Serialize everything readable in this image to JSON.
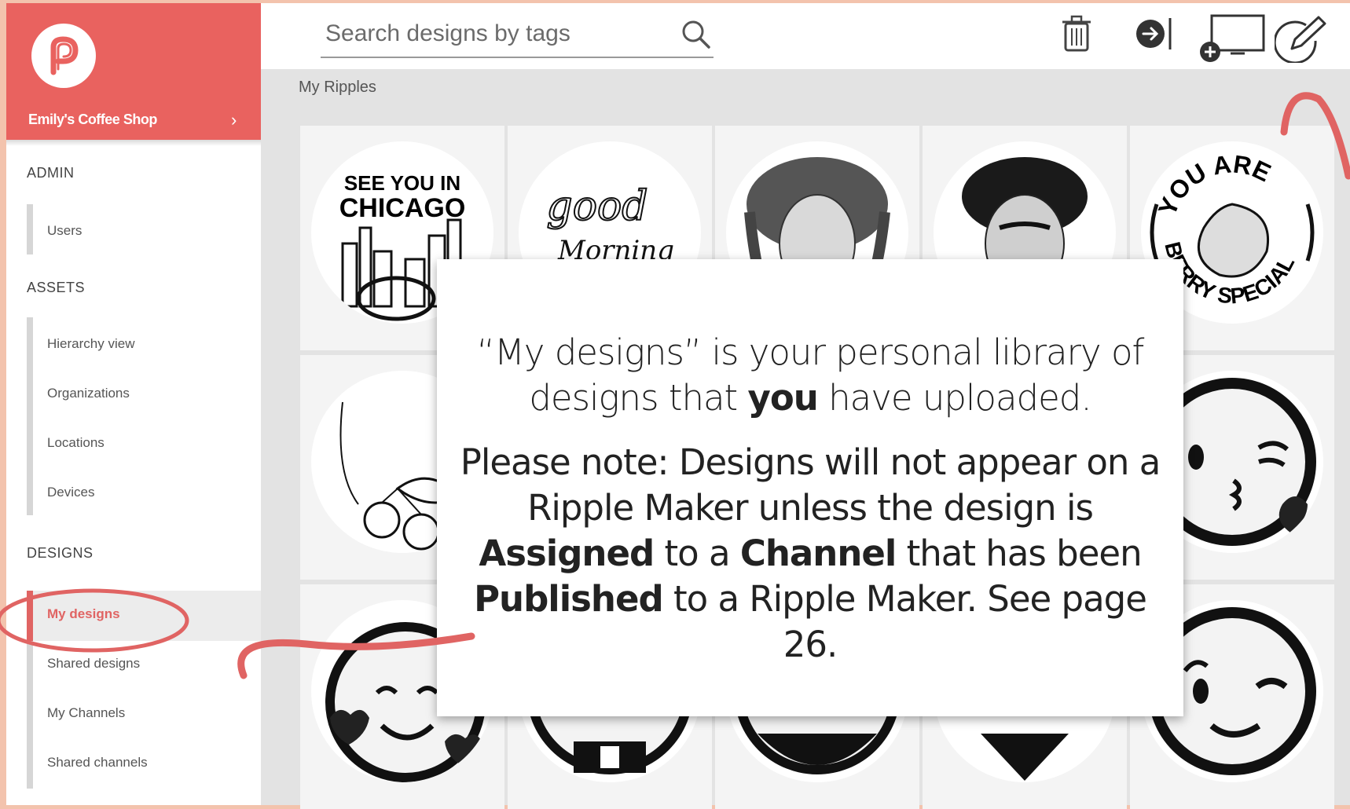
{
  "brand": {
    "shop_name": "Emily's Coffee Shop",
    "chevron": "›",
    "accent": "#e9625f"
  },
  "sidebar": {
    "sections": [
      {
        "title": "ADMIN",
        "items": [
          "Users"
        ]
      },
      {
        "title": "ASSETS",
        "items": [
          "Hierarchy view",
          "Organizations",
          "Locations",
          "Devices"
        ]
      },
      {
        "title": "DESIGNS",
        "items": [
          "My designs",
          "Shared designs",
          "My Channels",
          "Shared channels"
        ]
      }
    ],
    "active_item": "My designs"
  },
  "search": {
    "placeholder": "Search designs by tags"
  },
  "toolbar": {
    "icons": [
      "trash-icon",
      "arrow-to-end-icon",
      "add-display-icon",
      "edit-icon"
    ]
  },
  "breadcrumb": "My Ripples",
  "designs": [
    {
      "name": "see-you-in-chicago",
      "text": [
        "SEE YOU IN",
        "CHICAGO"
      ]
    },
    {
      "name": "good-morning",
      "text": [
        "good",
        "Morning"
      ]
    },
    {
      "name": "venus-portrait"
    },
    {
      "name": "frida-portrait"
    },
    {
      "name": "strawberry-special",
      "text": [
        "YOU ARE",
        "BERRY SPECIAL"
      ]
    },
    {
      "name": "cherries"
    },
    {
      "name": "kiss-emoji"
    },
    {
      "name": "smiling-hearts-emoji"
    },
    {
      "name": "laughing-emoji"
    },
    {
      "name": "grinning-emoji"
    },
    {
      "name": "heart-emoji"
    },
    {
      "name": "wink-emoji"
    }
  ],
  "overlay": {
    "p1_a": "“My designs” is your personal library of designs that ",
    "p1_b": "you",
    "p1_c": " have uploaded.",
    "p2_a": "Please note: Designs will not appear on a Ripple Maker unless the design is ",
    "p2_b": "Assigned",
    "p2_c": " to a ",
    "p2_d": "Channel",
    "p2_e": " that has been ",
    "p2_f": "Published",
    "p2_g": " to a Ripple Maker.  See page 26."
  }
}
